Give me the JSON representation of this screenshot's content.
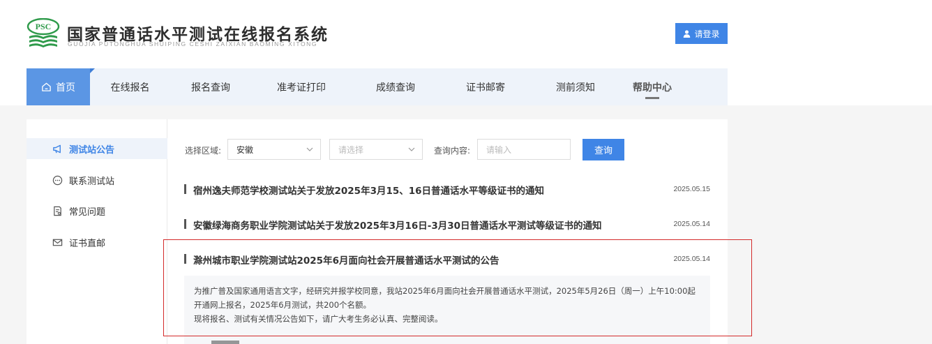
{
  "header": {
    "logo_text": "PSC",
    "title": "国家普通话水平测试在线报名系统",
    "subtitle": "GUOJIA PUTONGHUA SHUIPING CESHI ZAIXIAN BAOMING XITONG",
    "login_label": "请登录"
  },
  "nav": {
    "items": [
      {
        "label": "首页",
        "icon": "home-icon",
        "active": true
      },
      {
        "label": "在线报名"
      },
      {
        "label": "报名查询"
      },
      {
        "label": "准考证打印"
      },
      {
        "label": "成绩查询"
      },
      {
        "label": "证书邮寄"
      },
      {
        "label": "测前须知"
      },
      {
        "label": "帮助中心",
        "highlighted": true
      }
    ]
  },
  "sidebar": {
    "items": [
      {
        "label": "测试站公告",
        "icon": "megaphone-icon",
        "active": true
      },
      {
        "label": "联系测试站",
        "icon": "chat-icon"
      },
      {
        "label": "常见问题",
        "icon": "document-icon"
      },
      {
        "label": "证书直邮",
        "icon": "mail-icon"
      }
    ]
  },
  "filter": {
    "region_label": "选择区域:",
    "province_value": "安徽",
    "city_placeholder": "请选择",
    "query_label": "查询内容:",
    "query_placeholder": "请输入",
    "search_label": "查询"
  },
  "notices": [
    {
      "title": "宿州逸夫师范学校测试站关于发放2025年3月15、16日普通话水平等级证书的通知",
      "date": "2025.05.15"
    },
    {
      "title": "安徽绿海商务职业学院测试站关于发放2025年3月16日-3月30日普通话水平测试等级证书的通知",
      "date": "2025.05.14"
    },
    {
      "title": "滁州城市职业学院测试站2025年6月面向社会开展普通话水平测试的公告",
      "date": "2025.05.14"
    }
  ],
  "summary": {
    "line1": "为推广普及国家通用语言文字，经研究并报学校同意，我站2025年6月面向社会开展普通话水平测试，2025年5月26日（周一）上午10:00起",
    "line2": "开通网上报名，2025年6月测试，共200个名额。",
    "line3": "现将报名、测试有关情况公告如下，请广大考生务必认真、完整阅读。"
  },
  "colors": {
    "primary": "#3f85e6",
    "nav_bg": "#eef3fa",
    "highlight_border": "#d32a2a",
    "logo_green": "#2e9a4a"
  }
}
